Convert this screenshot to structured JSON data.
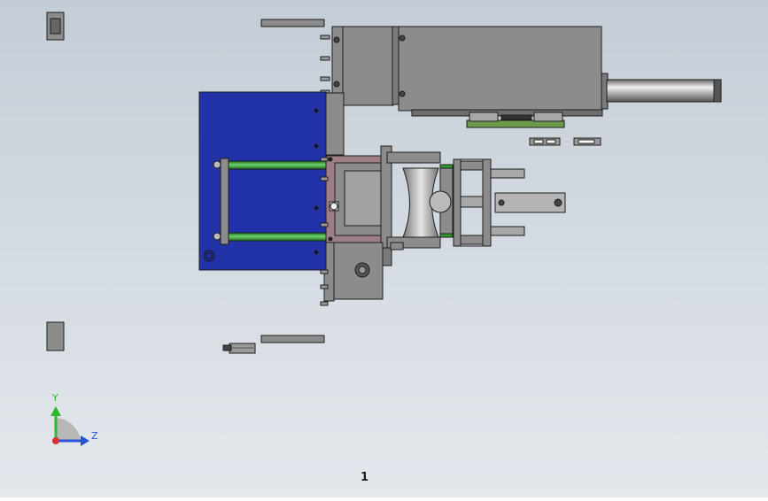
{
  "viewport": {
    "background_top": "#c4cdd6",
    "background_bottom": "#e4e8ed",
    "part_gray": "#8c8c8c",
    "part_dark": "#6e6e6e",
    "edge": "#1e1e1e",
    "plate_blue": "#2233aa",
    "rod_green": "#2f9a2f",
    "block_mauve": "#9e7f86",
    "rail_green": "#6b9a4a"
  },
  "triad": {
    "y_label": "Y",
    "z_label": "Z",
    "y_color": "#2db82d",
    "z_color": "#2b53d9",
    "x_color": "#d93030"
  },
  "sheet_label": "1"
}
